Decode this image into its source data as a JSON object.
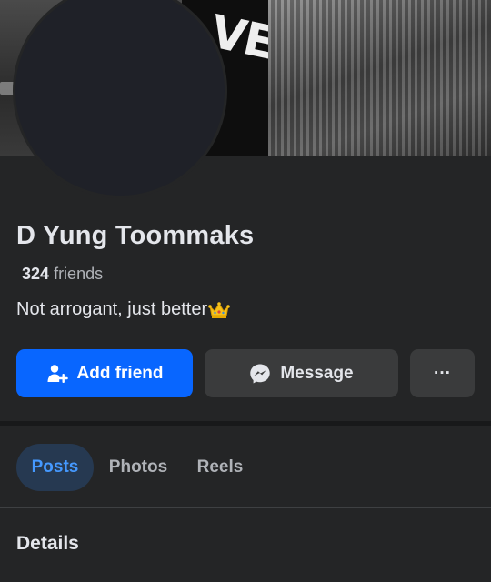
{
  "cover": {
    "sign_text": "VE"
  },
  "profile": {
    "name": "D Yung Toommaks",
    "friends_count": "324",
    "friends_label": "friends",
    "bio": "Not arrogant, just better",
    "bio_emoji_icon": "crown-icon"
  },
  "actions": {
    "add_friend_label": "Add friend",
    "add_friend_icon": "add-person-icon",
    "message_label": "Message",
    "message_icon": "messenger-icon",
    "more_label": "···"
  },
  "tabs": [
    {
      "label": "Posts",
      "active": true
    },
    {
      "label": "Photos",
      "active": false
    },
    {
      "label": "Reels",
      "active": false
    }
  ],
  "sections": {
    "details_heading": "Details"
  },
  "colors": {
    "background": "#242526",
    "primary_button": "#0866ff",
    "secondary_button": "#3a3b3c",
    "active_tab_bg": "#263951",
    "active_tab_text": "#4599ff",
    "text_primary": "#e4e6eb",
    "text_secondary": "#b0b3b8"
  }
}
